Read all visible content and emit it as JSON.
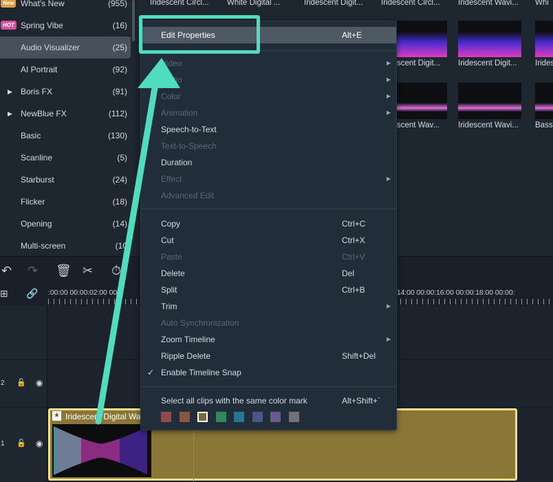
{
  "sidebar": {
    "items": [
      {
        "label": "What's New",
        "count": "(955)",
        "badge": "New",
        "badge_color": "#e0a040"
      },
      {
        "label": "Spring Vibe",
        "count": "(16)",
        "badge": "HOT",
        "badge_color": "#d94fa0"
      },
      {
        "label": "Audio Visualizer",
        "count": "(25)",
        "selected": true
      },
      {
        "label": "AI Portrait",
        "count": "(92)"
      },
      {
        "label": "Boris FX",
        "count": "(91)",
        "expandable": true
      },
      {
        "label": "NewBlue FX",
        "count": "(112)",
        "expandable": true
      },
      {
        "label": "Basic",
        "count": "(130)"
      },
      {
        "label": "Scanline",
        "count": "(5)"
      },
      {
        "label": "Starburst",
        "count": "(24)"
      },
      {
        "label": "Flicker",
        "count": "(18)"
      },
      {
        "label": "Opening",
        "count": "(14)"
      },
      {
        "label": "Multi-screen",
        "count": "(10"
      }
    ]
  },
  "grid": {
    "top_labels": [
      "Iridescent Circl...",
      "White  Digital ...",
      "Iridescent Digit...",
      "Iridescent Circl...",
      "Iridescent Wavi...",
      "Whi"
    ],
    "row1_labels": [
      "scent Digit...",
      "Iridescent Digit...",
      "Irides"
    ],
    "row2_labels": [
      "scent Wav...",
      "Iridescent Wavi...",
      "Bass"
    ]
  },
  "ruler": {
    "left": ":00:00  00:00:02:00  00:0",
    "right": ":14:00  00:00:16:00  00:00:18:00  00:00:"
  },
  "tracks": [
    {
      "number": "2"
    },
    {
      "number": "1"
    }
  ],
  "clip": {
    "title": "Iridescent Digital Wa"
  },
  "menu": {
    "items": [
      {
        "label": "Edit Properties",
        "shortcut": "Alt+E"
      },
      {
        "label": "Video"
      },
      {
        "label": "Audio"
      },
      {
        "label": "Color"
      },
      {
        "label": "Animation"
      },
      {
        "label": "Speech-to-Text"
      },
      {
        "label": "Text-to-Speech"
      },
      {
        "label": "Duration"
      },
      {
        "label": "Effect"
      },
      {
        "label": "Advanced Edit"
      },
      {
        "label": "Copy",
        "shortcut": "Ctrl+C"
      },
      {
        "label": "Cut",
        "shortcut": "Ctrl+X"
      },
      {
        "label": "Paste",
        "shortcut": "Ctrl+V"
      },
      {
        "label": "Delete",
        "shortcut": "Del"
      },
      {
        "label": "Split",
        "shortcut": "Ctrl+B"
      },
      {
        "label": "Trim"
      },
      {
        "label": "Auto Synchronization"
      },
      {
        "label": "Zoom Timeline"
      },
      {
        "label": "Ripple Delete",
        "shortcut": "Shift+Del"
      },
      {
        "label": "Enable Timeline Snap",
        "checked": true
      },
      {
        "label": "Select all clips with the same color mark",
        "shortcut": "Alt+Shift+`"
      }
    ],
    "check": "✓",
    "color_marks": [
      "#8e4a4e",
      "#8a553e",
      "#7a6a35",
      "#2e8a5e",
      "#2a7690",
      "#4a5590",
      "#6a5890",
      "#6f7277"
    ],
    "selected_color_index": 2
  },
  "annotation_color": "#4fdcbf"
}
